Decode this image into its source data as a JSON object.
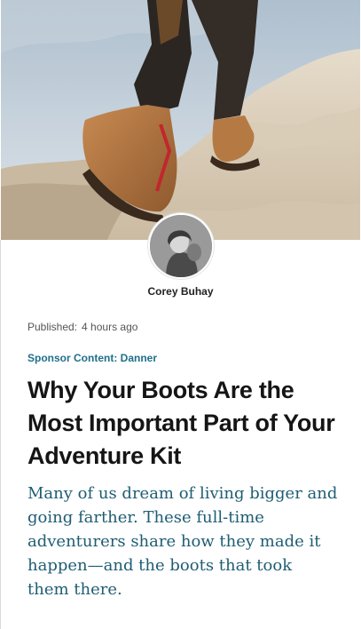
{
  "hero_image": {
    "alt_icon": "hiking-boots-photo"
  },
  "author": {
    "avatar_icon": "author-avatar",
    "name": "Corey Buhay"
  },
  "meta": {
    "published_label": "Published:",
    "published_time": "4 hours ago"
  },
  "sponsor": {
    "label": "Sponsor Content: Danner",
    "color": "#1f6f8b"
  },
  "article": {
    "headline": "Why Your Boots Are the Most Important Part of Your Adventure Kit",
    "dek": "Many of us dream of living bigger and going farther. These full-time adventurers share how they made it happen—and the boots that took them there."
  }
}
